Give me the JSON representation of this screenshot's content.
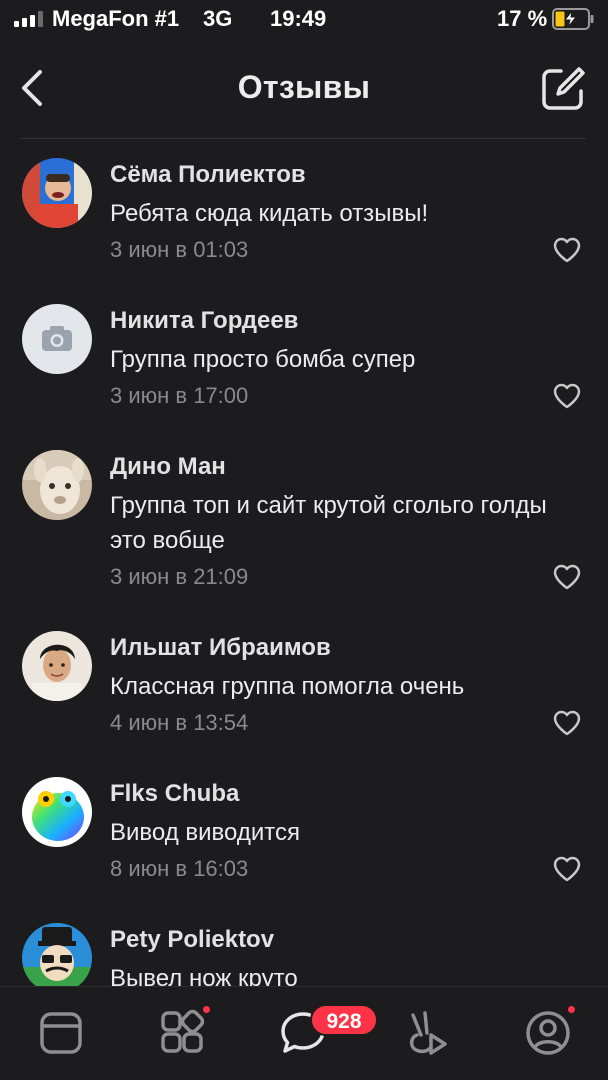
{
  "status_bar": {
    "carrier": "MegaFon #1",
    "network": "3G",
    "time": "19:49",
    "battery_percent": "17 %"
  },
  "header": {
    "title": "Отзывы",
    "back_icon": "chevron-left-icon",
    "edit_icon": "compose-icon"
  },
  "reviews": [
    {
      "author": "Сёма Полиектов",
      "text": "Ребята сюда кидать отзывы!",
      "date": "3 июн в 01:03"
    },
    {
      "author": "Никита Гордеев",
      "text": "Группа просто бомба супер",
      "date": "3 июн в 17:00"
    },
    {
      "author": "Дино Ман",
      "text": "Группа топ и сайт крутой сгольго голды это вобще",
      "date": "3 июн в 21:09"
    },
    {
      "author": "Ильшат Ибраимов",
      "text": "Классная группа помогла очень",
      "date": "4 июн в 13:54"
    },
    {
      "author": "Flks Chuba",
      "text": "Вивод виводится",
      "date": "8 июн в 16:03"
    },
    {
      "author": "Pety Poliektov",
      "text": "Вывел нож круто",
      "date": ""
    }
  ],
  "tabbar": {
    "items": [
      "news-icon",
      "services-icon",
      "messages-icon",
      "clips-icon",
      "profile-icon"
    ],
    "messages_badge": "928"
  },
  "colors": {
    "background": "#1c1c1e",
    "badge": "#ff3347",
    "secondary_text": "#8a8a8e"
  }
}
